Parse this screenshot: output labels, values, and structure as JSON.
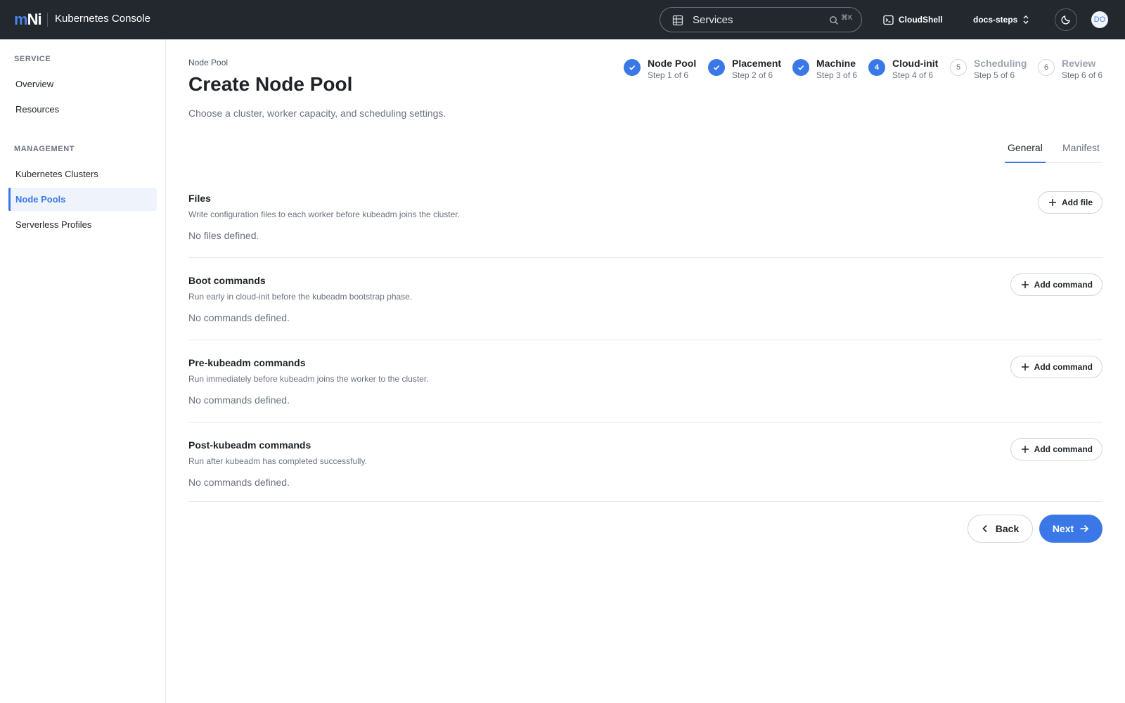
{
  "topbar": {
    "logo_left": "m",
    "logo_right": "Ni",
    "app_title": "Kubernetes Console",
    "search_label": "Services",
    "search_shortcut": "⌘K",
    "cloudshell_label": "CloudShell",
    "project_label": "docs-steps",
    "avatar_initials": "DO"
  },
  "sidebar": {
    "sections": [
      {
        "label": "SERVICE",
        "items": [
          {
            "label": "Overview"
          },
          {
            "label": "Resources"
          }
        ]
      },
      {
        "label": "MANAGEMENT",
        "items": [
          {
            "label": "Kubernetes Clusters"
          },
          {
            "label": "Node Pools",
            "active": true
          },
          {
            "label": "Serverless Profiles"
          }
        ]
      }
    ]
  },
  "page": {
    "breadcrumb": "Node Pool",
    "title": "Create Node Pool",
    "subtitle": "Choose a cluster, worker capacity, and scheduling settings."
  },
  "stepper": [
    {
      "name": "Node Pool",
      "sub": "Step 1 of 6",
      "state": "done",
      "number": "1"
    },
    {
      "name": "Placement",
      "sub": "Step 2 of 6",
      "state": "done",
      "number": "2"
    },
    {
      "name": "Machine",
      "sub": "Step 3 of 6",
      "state": "done",
      "number": "3"
    },
    {
      "name": "Cloud-init",
      "sub": "Step 4 of 6",
      "state": "current",
      "number": "4"
    },
    {
      "name": "Scheduling",
      "sub": "Step 5 of 6",
      "state": "todo",
      "number": "5"
    },
    {
      "name": "Review",
      "sub": "Step 6 of 6",
      "state": "todo",
      "number": "6"
    }
  ],
  "tabs": [
    {
      "label": "General",
      "active": true
    },
    {
      "label": "Manifest",
      "active": false
    }
  ],
  "sections": [
    {
      "title": "Files",
      "description": "Write configuration files to each worker before kubeadm joins the cluster.",
      "empty": "No files defined.",
      "button": "Add file"
    },
    {
      "title": "Boot commands",
      "description": "Run early in cloud-init before the kubeadm bootstrap phase.",
      "empty": "No commands defined.",
      "button": "Add command"
    },
    {
      "title": "Pre-kubeadm commands",
      "description": "Run immediately before kubeadm joins the worker to the cluster.",
      "empty": "No commands defined.",
      "button": "Add command"
    },
    {
      "title": "Post-kubeadm commands",
      "description": "Run after kubeadm has completed successfully.",
      "empty": "No commands defined.",
      "button": "Add command"
    }
  ],
  "footer": {
    "back_label": "Back",
    "next_label": "Next"
  },
  "colors": {
    "accent": "#3b78e7",
    "topbar": "#23272e"
  },
  "icons": {
    "search_left": "grid-icon",
    "search_right": "search-icon",
    "cloudshell": "terminal-icon",
    "project": "chevron-up-down-icon",
    "theme": "moon-icon",
    "done_step": "check-icon",
    "add": "plus-icon",
    "back": "chevron-left-icon",
    "next": "arrow-right-icon"
  }
}
